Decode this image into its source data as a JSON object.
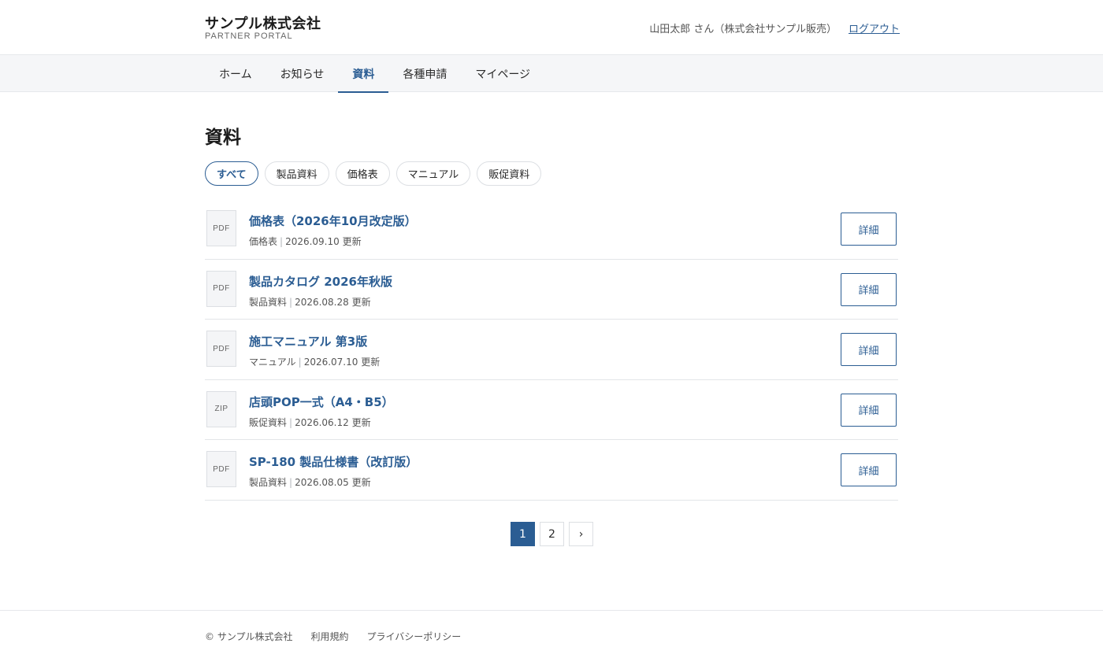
{
  "header": {
    "brand_name": "サンプル株式会社",
    "brand_sub": "PARTNER PORTAL",
    "user_info": "山田太郎 さん（株式会社サンプル販売）",
    "logout_label": "ログアウト"
  },
  "nav": {
    "items": [
      {
        "label": "ホーム"
      },
      {
        "label": "お知らせ"
      },
      {
        "label": "資料",
        "active": true
      },
      {
        "label": "各種申請"
      },
      {
        "label": "マイページ"
      }
    ]
  },
  "main": {
    "title": "資料",
    "filters": [
      {
        "label": "すべて",
        "active": true
      },
      {
        "label": "製品資料"
      },
      {
        "label": "価格表"
      },
      {
        "label": "マニュアル"
      },
      {
        "label": "販促資料"
      }
    ],
    "documents": [
      {
        "type": "PDF",
        "title": "価格表（2026年10月改定版）",
        "category": "価格表",
        "date": "2026.09.10 更新",
        "action": "詳細"
      },
      {
        "type": "PDF",
        "title": "製品カタログ 2026年秋版",
        "category": "製品資料",
        "date": "2026.08.28 更新",
        "action": "詳細"
      },
      {
        "type": "PDF",
        "title": "施工マニュアル 第3版",
        "category": "マニュアル",
        "date": "2026.07.10 更新",
        "action": "詳細"
      },
      {
        "type": "ZIP",
        "title": "店頭POP一式（A4・B5）",
        "category": "販促資料",
        "date": "2026.06.12 更新",
        "action": "詳細"
      },
      {
        "type": "PDF",
        "title": "SP-180 製品仕様書（改訂版）",
        "category": "製品資料",
        "date": "2026.08.05 更新",
        "action": "詳細"
      }
    ],
    "meta_separator": "|",
    "pagination": {
      "pages": [
        "1",
        "2"
      ],
      "current": "1",
      "next_label": "›"
    }
  },
  "footer": {
    "copyright": "© サンプル株式会社",
    "links": [
      "利用規約",
      "プライバシーポリシー"
    ]
  },
  "colors": {
    "accent": "#2b5d93",
    "nav_bg": "#f5f6f8",
    "border": "#e3e5e8"
  }
}
